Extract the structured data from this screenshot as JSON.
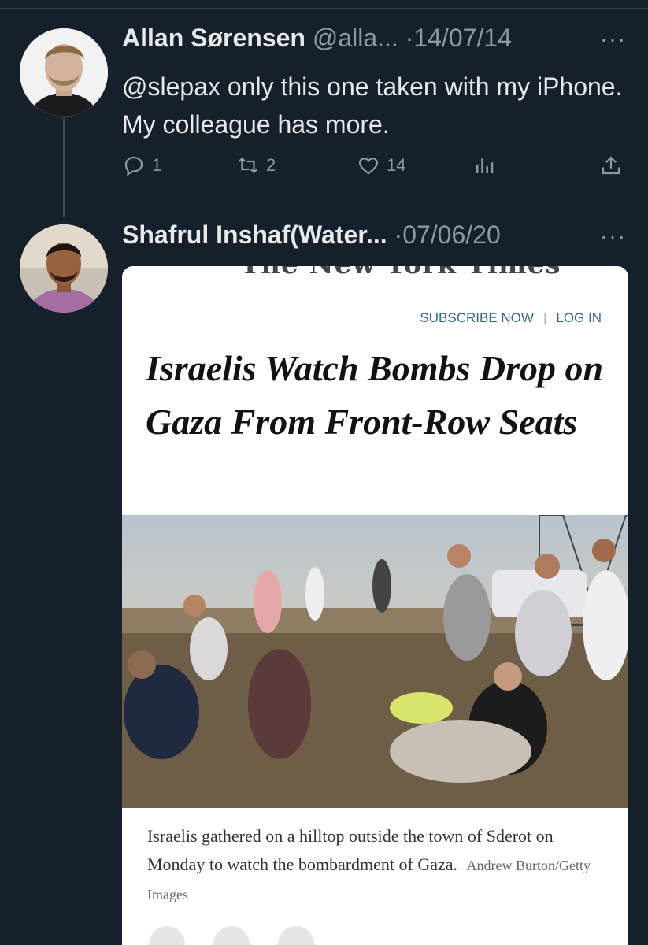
{
  "tweets": [
    {
      "name": "Allan Sørensen",
      "handle": "@alla...",
      "dot": "·",
      "date": "14/07/14",
      "more": "···",
      "text": "@slepax only this one taken with my iPhone. My colleague has more.",
      "replies": "1",
      "retweets": "2",
      "likes": "14"
    },
    {
      "name": "Shafrul Inshaf(Water...",
      "dot": "·",
      "date": "07/06/20",
      "more": "···"
    }
  ],
  "article": {
    "masthead": "The New York Times",
    "subscribe": "SUBSCRIBE NOW",
    "separator": "|",
    "login": "LOG IN",
    "headline": "Israelis Watch Bombs Drop on Gaza From Front-Row Seats",
    "caption": "Israelis gathered on a hilltop outside the town of Sderot on Monday to watch the bombardment of Gaza.",
    "credit": "Andrew Burton/Getty Images"
  },
  "colors": {
    "background": "#15202b",
    "text": "#e7e9ea",
    "muted": "#8b98a5",
    "link": "#326891"
  }
}
